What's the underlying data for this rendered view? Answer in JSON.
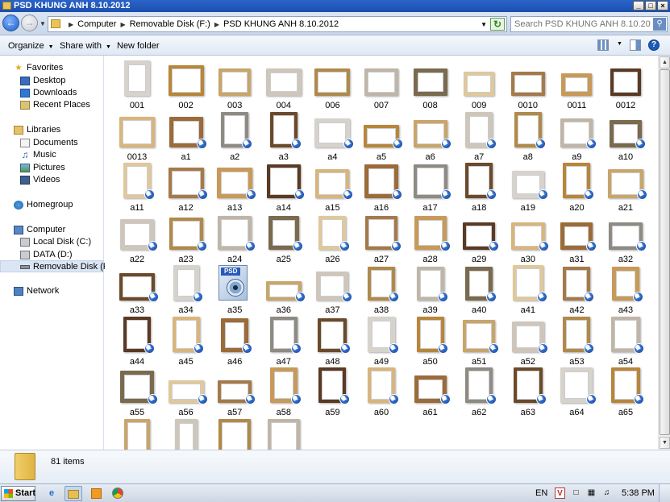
{
  "window": {
    "title": "PSD KHUNG ANH 8.10.2012",
    "buttons": [
      "_",
      "□",
      "×"
    ]
  },
  "address": {
    "breadcrumbs": [
      "Computer",
      "Removable Disk (F:)",
      "PSD KHUNG ANH 8.10.2012"
    ],
    "search_placeholder": "Search PSD KHUNG ANH 8.10.2012"
  },
  "toolbar": {
    "organize": "Organize",
    "share_with": "Share with",
    "new_folder": "New folder"
  },
  "nav": {
    "favorites": "Favorites",
    "desktop": "Desktop",
    "downloads": "Downloads",
    "recent_places": "Recent Places",
    "libraries": "Libraries",
    "documents": "Documents",
    "music": "Music",
    "pictures": "Pictures",
    "videos": "Videos",
    "homegroup": "Homegroup",
    "computer": "Computer",
    "local_disk": "Local Disk (C:)",
    "data_disk": "DATA (D:)",
    "removable_disk": "Removable Disk (F:)",
    "network": "Network"
  },
  "files": [
    {
      "name": "001",
      "shortcut": false
    },
    {
      "name": "002",
      "shortcut": false
    },
    {
      "name": "003",
      "shortcut": false
    },
    {
      "name": "004",
      "shortcut": false
    },
    {
      "name": "006",
      "shortcut": false
    },
    {
      "name": "007",
      "shortcut": false
    },
    {
      "name": "008",
      "shortcut": false
    },
    {
      "name": "009",
      "shortcut": false
    },
    {
      "name": "0010",
      "shortcut": false
    },
    {
      "name": "0011",
      "shortcut": false
    },
    {
      "name": "0012",
      "shortcut": false
    },
    {
      "name": "0013",
      "shortcut": false
    },
    {
      "name": "a1",
      "shortcut": true
    },
    {
      "name": "a2",
      "shortcut": true
    },
    {
      "name": "a3",
      "shortcut": true
    },
    {
      "name": "a4",
      "shortcut": true
    },
    {
      "name": "a5",
      "shortcut": true
    },
    {
      "name": "a6",
      "shortcut": true
    },
    {
      "name": "a7",
      "shortcut": true
    },
    {
      "name": "a8",
      "shortcut": true
    },
    {
      "name": "a9",
      "shortcut": true
    },
    {
      "name": "a10",
      "shortcut": true
    },
    {
      "name": "a11",
      "shortcut": true
    },
    {
      "name": "a12",
      "shortcut": true
    },
    {
      "name": "a13",
      "shortcut": true
    },
    {
      "name": "a14",
      "shortcut": true
    },
    {
      "name": "a15",
      "shortcut": true
    },
    {
      "name": "a16",
      "shortcut": true
    },
    {
      "name": "a17",
      "shortcut": true
    },
    {
      "name": "a18",
      "shortcut": true
    },
    {
      "name": "a19",
      "shortcut": true
    },
    {
      "name": "a20",
      "shortcut": true
    },
    {
      "name": "a21",
      "shortcut": true
    },
    {
      "name": "a22",
      "shortcut": true
    },
    {
      "name": "a23",
      "shortcut": true
    },
    {
      "name": "a24",
      "shortcut": true
    },
    {
      "name": "a25",
      "shortcut": true
    },
    {
      "name": "a26",
      "shortcut": true
    },
    {
      "name": "a27",
      "shortcut": true
    },
    {
      "name": "a28",
      "shortcut": true
    },
    {
      "name": "a29",
      "shortcut": true
    },
    {
      "name": "a30",
      "shortcut": true
    },
    {
      "name": "a31",
      "shortcut": true
    },
    {
      "name": "a32",
      "shortcut": true
    },
    {
      "name": "a33",
      "shortcut": true
    },
    {
      "name": "a34",
      "shortcut": true
    },
    {
      "name": "a35",
      "shortcut": false,
      "psd": true
    },
    {
      "name": "a36",
      "shortcut": true
    },
    {
      "name": "a37",
      "shortcut": true
    },
    {
      "name": "a38",
      "shortcut": true
    },
    {
      "name": "a39",
      "shortcut": true
    },
    {
      "name": "a40",
      "shortcut": true
    },
    {
      "name": "a41",
      "shortcut": true
    },
    {
      "name": "a42",
      "shortcut": true
    },
    {
      "name": "a43",
      "shortcut": true
    },
    {
      "name": "a44",
      "shortcut": true
    },
    {
      "name": "a45",
      "shortcut": true
    },
    {
      "name": "a46",
      "shortcut": true
    },
    {
      "name": "a47",
      "shortcut": true
    },
    {
      "name": "a48",
      "shortcut": true
    },
    {
      "name": "a49",
      "shortcut": true
    },
    {
      "name": "a50",
      "shortcut": true
    },
    {
      "name": "a51",
      "shortcut": true
    },
    {
      "name": "a52",
      "shortcut": true
    },
    {
      "name": "a53",
      "shortcut": true
    },
    {
      "name": "a54",
      "shortcut": true
    },
    {
      "name": "a55",
      "shortcut": true
    },
    {
      "name": "a56",
      "shortcut": true
    },
    {
      "name": "a57",
      "shortcut": true
    },
    {
      "name": "a58",
      "shortcut": true
    },
    {
      "name": "a59",
      "shortcut": true
    },
    {
      "name": "a60",
      "shortcut": true
    },
    {
      "name": "a61",
      "shortcut": true
    },
    {
      "name": "a62",
      "shortcut": true
    },
    {
      "name": "a63",
      "shortcut": true
    },
    {
      "name": "a64",
      "shortcut": true
    },
    {
      "name": "a65",
      "shortcut": true
    },
    {
      "name": "",
      "shortcut": false
    },
    {
      "name": "",
      "shortcut": false
    },
    {
      "name": "",
      "shortcut": false
    },
    {
      "name": "",
      "shortcut": false
    }
  ],
  "frame_colors": [
    "#7a6a4e",
    "#b08a4a",
    "#c9a56a",
    "#d6d2cc",
    "#8e8a84",
    "#d9b57c",
    "#c79a5a",
    "#e0c89a",
    "#bfb5a8",
    "#cfc6bb",
    "#b8863a",
    "#6b4a2a",
    "#9c6b3a",
    "#5a3a24",
    "#a57a4a"
  ],
  "status": {
    "item_count": "81 items"
  },
  "taskbar": {
    "start": "Start",
    "language": "EN",
    "time": "5:38 PM"
  }
}
